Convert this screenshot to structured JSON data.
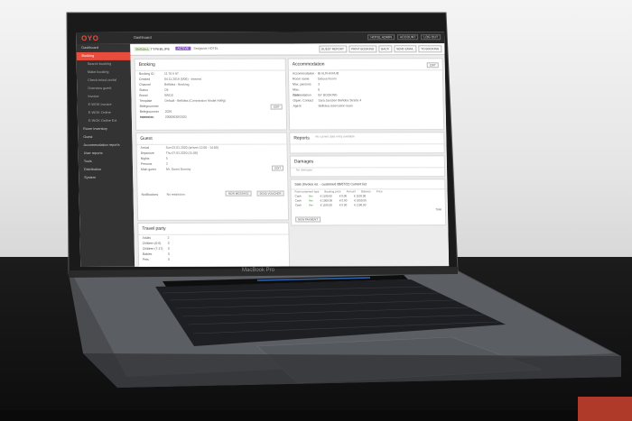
{
  "scene": {
    "laptop_label": "MacBook Pro"
  },
  "app": {
    "logo": "OYO",
    "breadcrumb": "Dashboard",
    "top_nav": [
      "HOTEL ADMIN",
      "ACCOUNT",
      "LOG OUT"
    ]
  },
  "sidebar": {
    "items": [
      {
        "label": "Dashboard",
        "active": false
      },
      {
        "label": "Booking",
        "active": true
      },
      {
        "label": "Search booking",
        "active": false,
        "sub": true
      },
      {
        "label": "Make booking",
        "active": false,
        "sub": true
      },
      {
        "label": "Check-in/out portal",
        "active": false,
        "sub": true
      },
      {
        "label": "Overview guest",
        "active": false,
        "sub": true
      },
      {
        "label": "Invoice",
        "active": false,
        "sub": true
      },
      {
        "label": "E-WOK Invoice",
        "active": false,
        "sub": true
      },
      {
        "label": "E-WOK Online",
        "active": false,
        "sub": true
      },
      {
        "label": "E-WOK Online Ext",
        "active": false,
        "sub": true
      },
      {
        "label": "Room Inventory",
        "active": false
      },
      {
        "label": "Guest",
        "active": false
      },
      {
        "label": "Accommodation reports",
        "active": false
      },
      {
        "label": "User reports",
        "active": false
      },
      {
        "label": "Tools",
        "active": false
      },
      {
        "label": "Distribution",
        "active": false
      },
      {
        "label": "System",
        "active": false
      }
    ]
  },
  "toolbar": {
    "booking_id": "Bellidea",
    "name": "TYPEBLIPE",
    "status": "ACTIVE",
    "hotel": "Sedgwick HOTEL",
    "actions": [
      "GUEST REPORT",
      "PRINT BOOKING",
      "BACK",
      "SEND EMAIL",
      "TO BOOKING"
    ]
  },
  "booking_panel": {
    "title": "Booking",
    "rows": [
      [
        "Booking ID",
        "11 76 A 97"
      ],
      [
        "Created",
        "04.11.2019 (5/06) - Internet"
      ],
      [
        "Channel",
        "Bellidea - Booking"
      ],
      [
        "Status",
        "Ok"
      ],
      [
        "Brand",
        "BRDS"
      ],
      [
        "Template",
        "Default - Bellidea (Commission Model Hollig)"
      ],
      [
        "Belegnummer",
        ""
      ],
      [
        "Belegnummer extension",
        "2026"
      ],
      [
        "Invoice no.",
        "20000030/2020"
      ]
    ],
    "edit_label": "EDIT"
  },
  "accommodation_panel": {
    "title": "Accommodation",
    "rows": [
      [
        "Accommodation",
        "BI ALPHA/HUB"
      ],
      [
        "Room name",
        "Deluxe Room"
      ],
      [
        "Max. persons",
        "3"
      ],
      [
        "Max. commodation",
        "0"
      ],
      [
        "Rate",
        "BY BOOKING"
      ],
      [
        "Oqwn. Contact",
        "Sara Janssen Bellidea Straße 4"
      ],
      [
        "Agent",
        "Bellidea reservation team"
      ]
    ],
    "edit_label": "EDIT"
  },
  "guest_panel": {
    "title": "Guest",
    "rows": [
      [
        "Arrival",
        "Sun 02.01.2020 (arrives 12:00 - 14:00)"
      ],
      [
        "Departure",
        "Thu 07.01.2020 (11:00)"
      ],
      [
        "Nights",
        "5"
      ],
      [
        "Persons",
        "2"
      ],
      [
        "Main guest",
        "Mr. Guest Dummy"
      ],
      [
        "Notifications",
        "No restriction"
      ]
    ],
    "buttons": [
      "EDIT",
      "NEW MESSAGE",
      "SEND VOUCHER"
    ]
  },
  "reports_panel": {
    "title": "Reports",
    "note": "No current data entry available"
  },
  "damages_panel": {
    "title": "Damages",
    "note": "No damages"
  },
  "sale_panel": {
    "title": "Sale (Invoice no. - customer) 08/07/22 Current list",
    "headers": [
      "Room payment type",
      "Booking price",
      "Amount",
      "Balance",
      "Price"
    ],
    "rows": [
      [
        "Cash",
        "Yes",
        "€ 1100.00",
        "€ 0.00",
        "€ 1100.00"
      ],
      [
        "Cash",
        "Yes",
        "€ 1050.00",
        "€ 0.00",
        "€ 1050.00"
      ],
      [
        "Cash",
        "Yes",
        "€ 1100.00",
        "€ 0.00",
        "€ 1100.00"
      ]
    ],
    "total_label": "Total",
    "button": "NEW PAYMENT"
  },
  "travel_party_panel": {
    "title": "Travel party",
    "rows": [
      [
        "Adults",
        "2"
      ],
      [
        "Children (0-6)",
        "0"
      ],
      [
        "Children (7-17)",
        "0"
      ],
      [
        "Babies",
        "0"
      ],
      [
        "Pets",
        "0"
      ]
    ]
  },
  "colors": {
    "accent": "#e84c3d",
    "sidebar": "#333333",
    "topbar": "#2b2b2b"
  }
}
